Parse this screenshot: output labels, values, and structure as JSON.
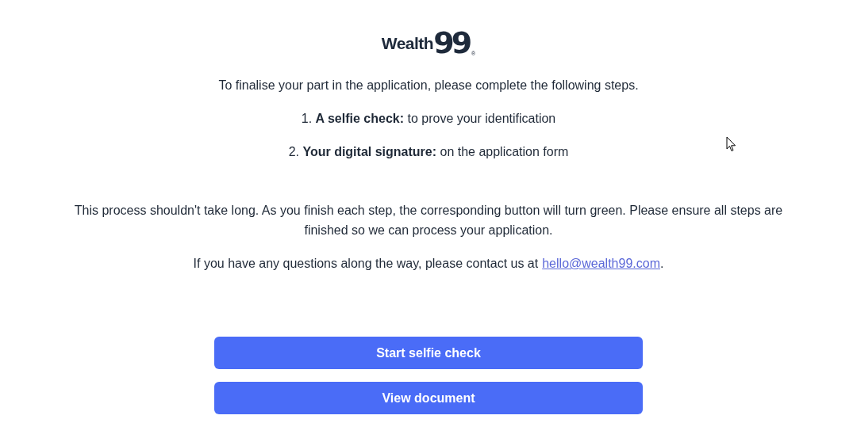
{
  "logo": {
    "name": "Wealth",
    "mark": "99",
    "registered": "®"
  },
  "intro": "To finalise your part in the application, please complete the following steps.",
  "steps": [
    {
      "number": "1.",
      "text": "**A selfie check:** to prove your identification"
    },
    {
      "number": "2.",
      "text": "**Your digital signature:** on the application form"
    }
  ],
  "note": "This process shouldn't take long. As you finish each step, the corresponding button will turn green. Please ensure all steps are finished so we can process your application.",
  "contact": {
    "before": "If you have any questions along the way, please contact us at",
    "link": "hello@wealth99.com",
    "after": "."
  },
  "buttons": [
    {
      "label": "Start selfie check",
      "done": false
    },
    {
      "label": "View document",
      "done": false
    }
  ]
}
